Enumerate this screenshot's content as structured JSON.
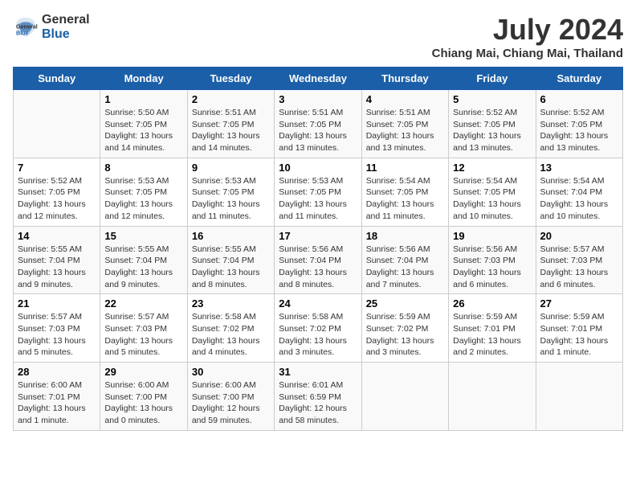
{
  "logo": {
    "general": "General",
    "blue": "Blue"
  },
  "header": {
    "month": "July 2024",
    "location": "Chiang Mai, Chiang Mai, Thailand"
  },
  "weekdays": [
    "Sunday",
    "Monday",
    "Tuesday",
    "Wednesday",
    "Thursday",
    "Friday",
    "Saturday"
  ],
  "weeks": [
    [
      {
        "day": "",
        "info": ""
      },
      {
        "day": "1",
        "info": "Sunrise: 5:50 AM\nSunset: 7:05 PM\nDaylight: 13 hours\nand 14 minutes."
      },
      {
        "day": "2",
        "info": "Sunrise: 5:51 AM\nSunset: 7:05 PM\nDaylight: 13 hours\nand 14 minutes."
      },
      {
        "day": "3",
        "info": "Sunrise: 5:51 AM\nSunset: 7:05 PM\nDaylight: 13 hours\nand 13 minutes."
      },
      {
        "day": "4",
        "info": "Sunrise: 5:51 AM\nSunset: 7:05 PM\nDaylight: 13 hours\nand 13 minutes."
      },
      {
        "day": "5",
        "info": "Sunrise: 5:52 AM\nSunset: 7:05 PM\nDaylight: 13 hours\nand 13 minutes."
      },
      {
        "day": "6",
        "info": "Sunrise: 5:52 AM\nSunset: 7:05 PM\nDaylight: 13 hours\nand 13 minutes."
      }
    ],
    [
      {
        "day": "7",
        "info": "Sunrise: 5:52 AM\nSunset: 7:05 PM\nDaylight: 13 hours\nand 12 minutes."
      },
      {
        "day": "8",
        "info": "Sunrise: 5:53 AM\nSunset: 7:05 PM\nDaylight: 13 hours\nand 12 minutes."
      },
      {
        "day": "9",
        "info": "Sunrise: 5:53 AM\nSunset: 7:05 PM\nDaylight: 13 hours\nand 11 minutes."
      },
      {
        "day": "10",
        "info": "Sunrise: 5:53 AM\nSunset: 7:05 PM\nDaylight: 13 hours\nand 11 minutes."
      },
      {
        "day": "11",
        "info": "Sunrise: 5:54 AM\nSunset: 7:05 PM\nDaylight: 13 hours\nand 11 minutes."
      },
      {
        "day": "12",
        "info": "Sunrise: 5:54 AM\nSunset: 7:05 PM\nDaylight: 13 hours\nand 10 minutes."
      },
      {
        "day": "13",
        "info": "Sunrise: 5:54 AM\nSunset: 7:04 PM\nDaylight: 13 hours\nand 10 minutes."
      }
    ],
    [
      {
        "day": "14",
        "info": "Sunrise: 5:55 AM\nSunset: 7:04 PM\nDaylight: 13 hours\nand 9 minutes."
      },
      {
        "day": "15",
        "info": "Sunrise: 5:55 AM\nSunset: 7:04 PM\nDaylight: 13 hours\nand 9 minutes."
      },
      {
        "day": "16",
        "info": "Sunrise: 5:55 AM\nSunset: 7:04 PM\nDaylight: 13 hours\nand 8 minutes."
      },
      {
        "day": "17",
        "info": "Sunrise: 5:56 AM\nSunset: 7:04 PM\nDaylight: 13 hours\nand 8 minutes."
      },
      {
        "day": "18",
        "info": "Sunrise: 5:56 AM\nSunset: 7:04 PM\nDaylight: 13 hours\nand 7 minutes."
      },
      {
        "day": "19",
        "info": "Sunrise: 5:56 AM\nSunset: 7:03 PM\nDaylight: 13 hours\nand 6 minutes."
      },
      {
        "day": "20",
        "info": "Sunrise: 5:57 AM\nSunset: 7:03 PM\nDaylight: 13 hours\nand 6 minutes."
      }
    ],
    [
      {
        "day": "21",
        "info": "Sunrise: 5:57 AM\nSunset: 7:03 PM\nDaylight: 13 hours\nand 5 minutes."
      },
      {
        "day": "22",
        "info": "Sunrise: 5:57 AM\nSunset: 7:03 PM\nDaylight: 13 hours\nand 5 minutes."
      },
      {
        "day": "23",
        "info": "Sunrise: 5:58 AM\nSunset: 7:02 PM\nDaylight: 13 hours\nand 4 minutes."
      },
      {
        "day": "24",
        "info": "Sunrise: 5:58 AM\nSunset: 7:02 PM\nDaylight: 13 hours\nand 3 minutes."
      },
      {
        "day": "25",
        "info": "Sunrise: 5:59 AM\nSunset: 7:02 PM\nDaylight: 13 hours\nand 3 minutes."
      },
      {
        "day": "26",
        "info": "Sunrise: 5:59 AM\nSunset: 7:01 PM\nDaylight: 13 hours\nand 2 minutes."
      },
      {
        "day": "27",
        "info": "Sunrise: 5:59 AM\nSunset: 7:01 PM\nDaylight: 13 hours\nand 1 minute."
      }
    ],
    [
      {
        "day": "28",
        "info": "Sunrise: 6:00 AM\nSunset: 7:01 PM\nDaylight: 13 hours\nand 1 minute."
      },
      {
        "day": "29",
        "info": "Sunrise: 6:00 AM\nSunset: 7:00 PM\nDaylight: 13 hours\nand 0 minutes."
      },
      {
        "day": "30",
        "info": "Sunrise: 6:00 AM\nSunset: 7:00 PM\nDaylight: 12 hours\nand 59 minutes."
      },
      {
        "day": "31",
        "info": "Sunrise: 6:01 AM\nSunset: 6:59 PM\nDaylight: 12 hours\nand 58 minutes."
      },
      {
        "day": "",
        "info": ""
      },
      {
        "day": "",
        "info": ""
      },
      {
        "day": "",
        "info": ""
      }
    ]
  ]
}
